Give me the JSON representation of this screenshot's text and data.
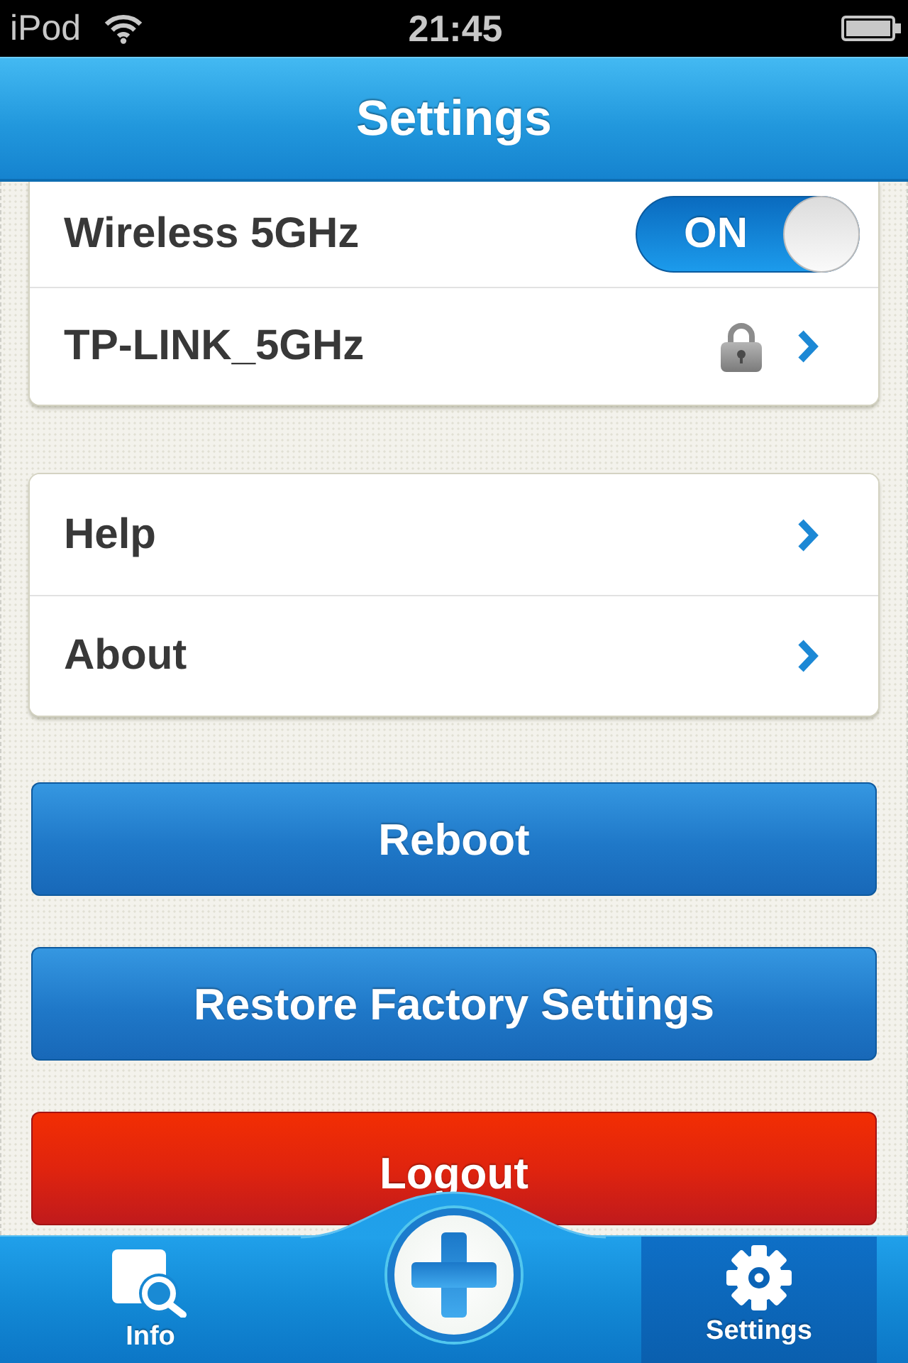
{
  "status_bar": {
    "carrier": "iPod",
    "time": "21:45"
  },
  "header": {
    "title": "Settings"
  },
  "groups": [
    {
      "rows": [
        {
          "kind": "toggle",
          "label": "Wireless 5GHz",
          "on": true,
          "state_text": "ON"
        },
        {
          "kind": "network",
          "label": "TP-LINK_5GHz",
          "locked": true
        }
      ]
    },
    {
      "rows": [
        {
          "kind": "link",
          "label": "Help"
        },
        {
          "kind": "link",
          "label": "About"
        }
      ]
    }
  ],
  "buttons": [
    {
      "kind": "primary",
      "label": "Reboot"
    },
    {
      "kind": "primary",
      "label": "Restore Factory Settings"
    },
    {
      "kind": "danger",
      "label": "Logout"
    }
  ],
  "tab_bar": {
    "tabs": [
      {
        "kind": "info",
        "label": "Info",
        "selected": false
      },
      {
        "kind": "settings",
        "label": "Settings",
        "selected": true
      }
    ]
  }
}
